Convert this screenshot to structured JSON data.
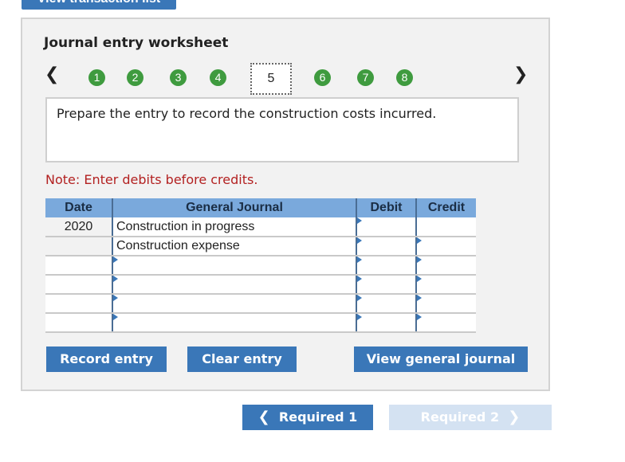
{
  "top_button": {
    "label": "View transaction list"
  },
  "worksheet": {
    "title": "Journal entry worksheet",
    "prev_icon": "chevron-left",
    "next_icon": "chevron-right",
    "steps": [
      "1",
      "2",
      "3",
      "4",
      "5",
      "6",
      "7",
      "8"
    ],
    "current_step": "5",
    "instruction": "Prepare the entry to record the construction costs incurred.",
    "note": "Note: Enter debits before credits.",
    "accent_color": "#3a77b8",
    "step_color": "#3f9b3f",
    "note_color": "#b32121"
  },
  "journal": {
    "headers": {
      "date": "Date",
      "account": "General Journal",
      "debit": "Debit",
      "credit": "Credit"
    },
    "rows": [
      {
        "date": "2020",
        "account": "Construction in progress",
        "debit": "",
        "credit": ""
      },
      {
        "date": "",
        "account": "Construction expense",
        "debit": "",
        "credit": ""
      },
      {
        "date": "",
        "account": "",
        "debit": "",
        "credit": ""
      },
      {
        "date": "",
        "account": "",
        "debit": "",
        "credit": ""
      },
      {
        "date": "",
        "account": "",
        "debit": "",
        "credit": ""
      },
      {
        "date": "",
        "account": "",
        "debit": "",
        "credit": ""
      }
    ]
  },
  "buttons": {
    "record": "Record entry",
    "clear": "Clear entry",
    "view_journal": "View general journal"
  },
  "requirements": {
    "prev_label": "Required 1",
    "next_label": "Required 2",
    "prev_icon": "chevron-left",
    "next_icon": "chevron-right"
  }
}
